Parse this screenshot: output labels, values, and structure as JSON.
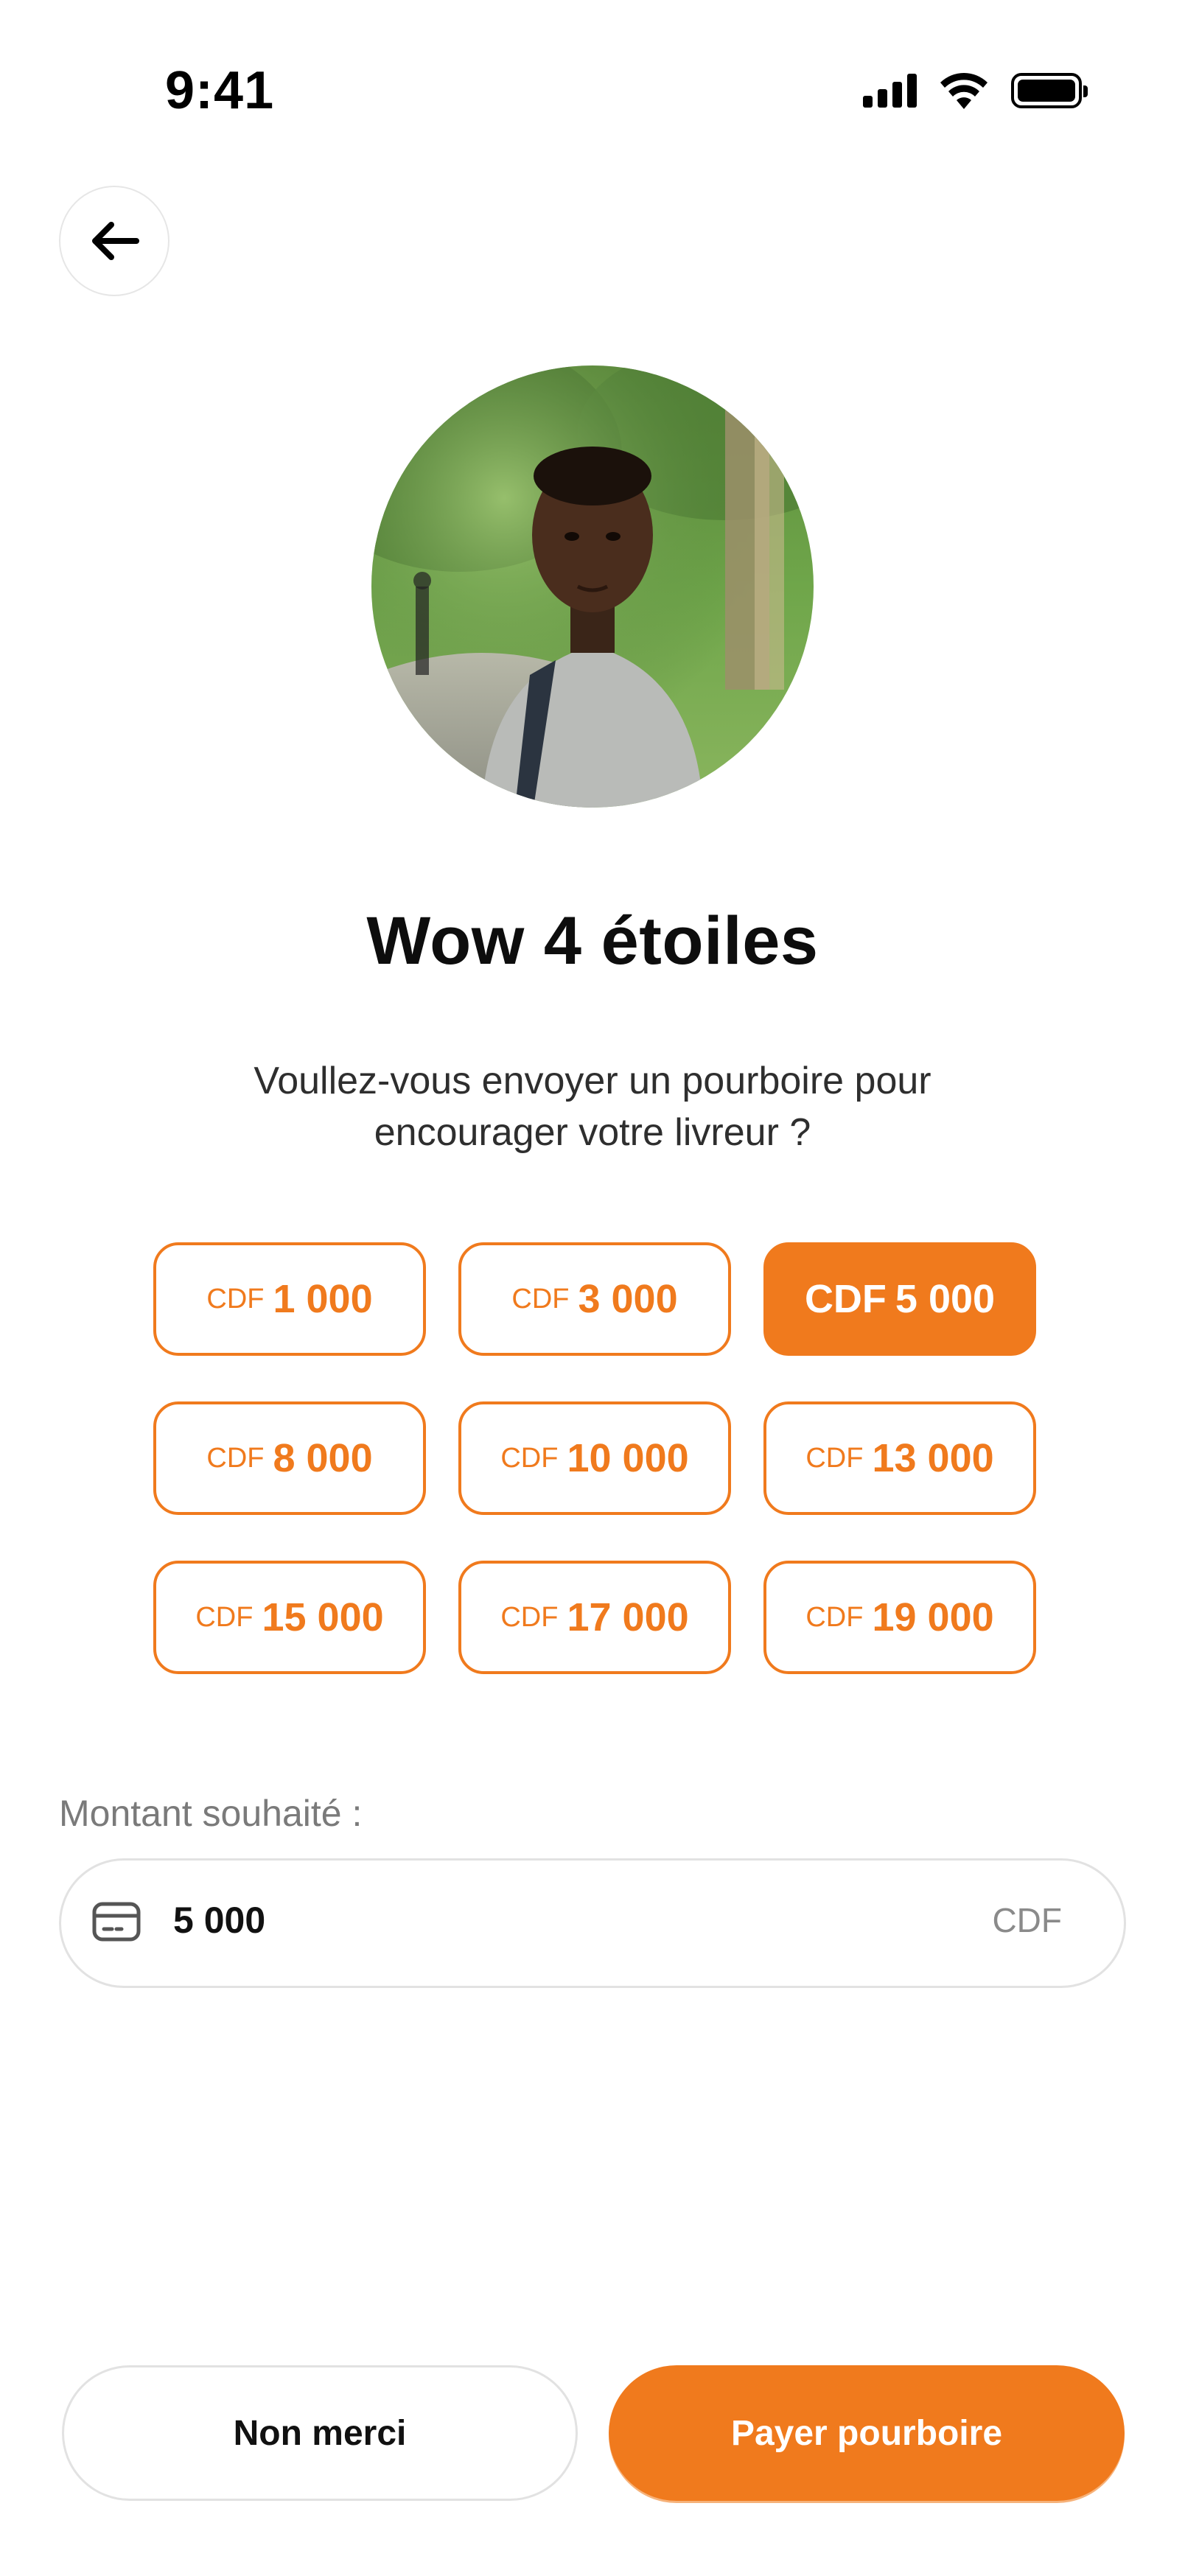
{
  "status_bar": {
    "time": "9:41",
    "signal_icon": "cellular-signal-icon",
    "wifi_icon": "wifi-icon",
    "battery_icon": "battery-icon"
  },
  "header": {
    "back_icon": "arrow-left-icon"
  },
  "courier": {
    "avatar": "courier-photo"
  },
  "title": "Wow 4 étoiles",
  "subtitle": "Voullez-vous envoyer un pourboire pour encourager votre livreur ?",
  "amounts": [
    {
      "currency": "CDF",
      "value": "1 000",
      "selected": false
    },
    {
      "currency": "CDF",
      "value": "3 000",
      "selected": false
    },
    {
      "currency": "CDF",
      "value": "5 000",
      "selected": true
    },
    {
      "currency": "CDF",
      "value": "8 000",
      "selected": false
    },
    {
      "currency": "CDF",
      "value": "10 000",
      "selected": false
    },
    {
      "currency": "CDF",
      "value": "13 000",
      "selected": false
    },
    {
      "currency": "CDF",
      "value": "15 000",
      "selected": false
    },
    {
      "currency": "CDF",
      "value": "17 000",
      "selected": false
    },
    {
      "currency": "CDF",
      "value": "19 000",
      "selected": false
    }
  ],
  "desired_amount": {
    "label": "Montant souhaité :",
    "icon": "card-icon",
    "value": "5 000",
    "currency": "CDF"
  },
  "actions": {
    "decline_label": "Non merci",
    "pay_label": "Payer pourboire"
  },
  "colors": {
    "accent": "#f07a1d",
    "border": "#e2e2e2"
  }
}
